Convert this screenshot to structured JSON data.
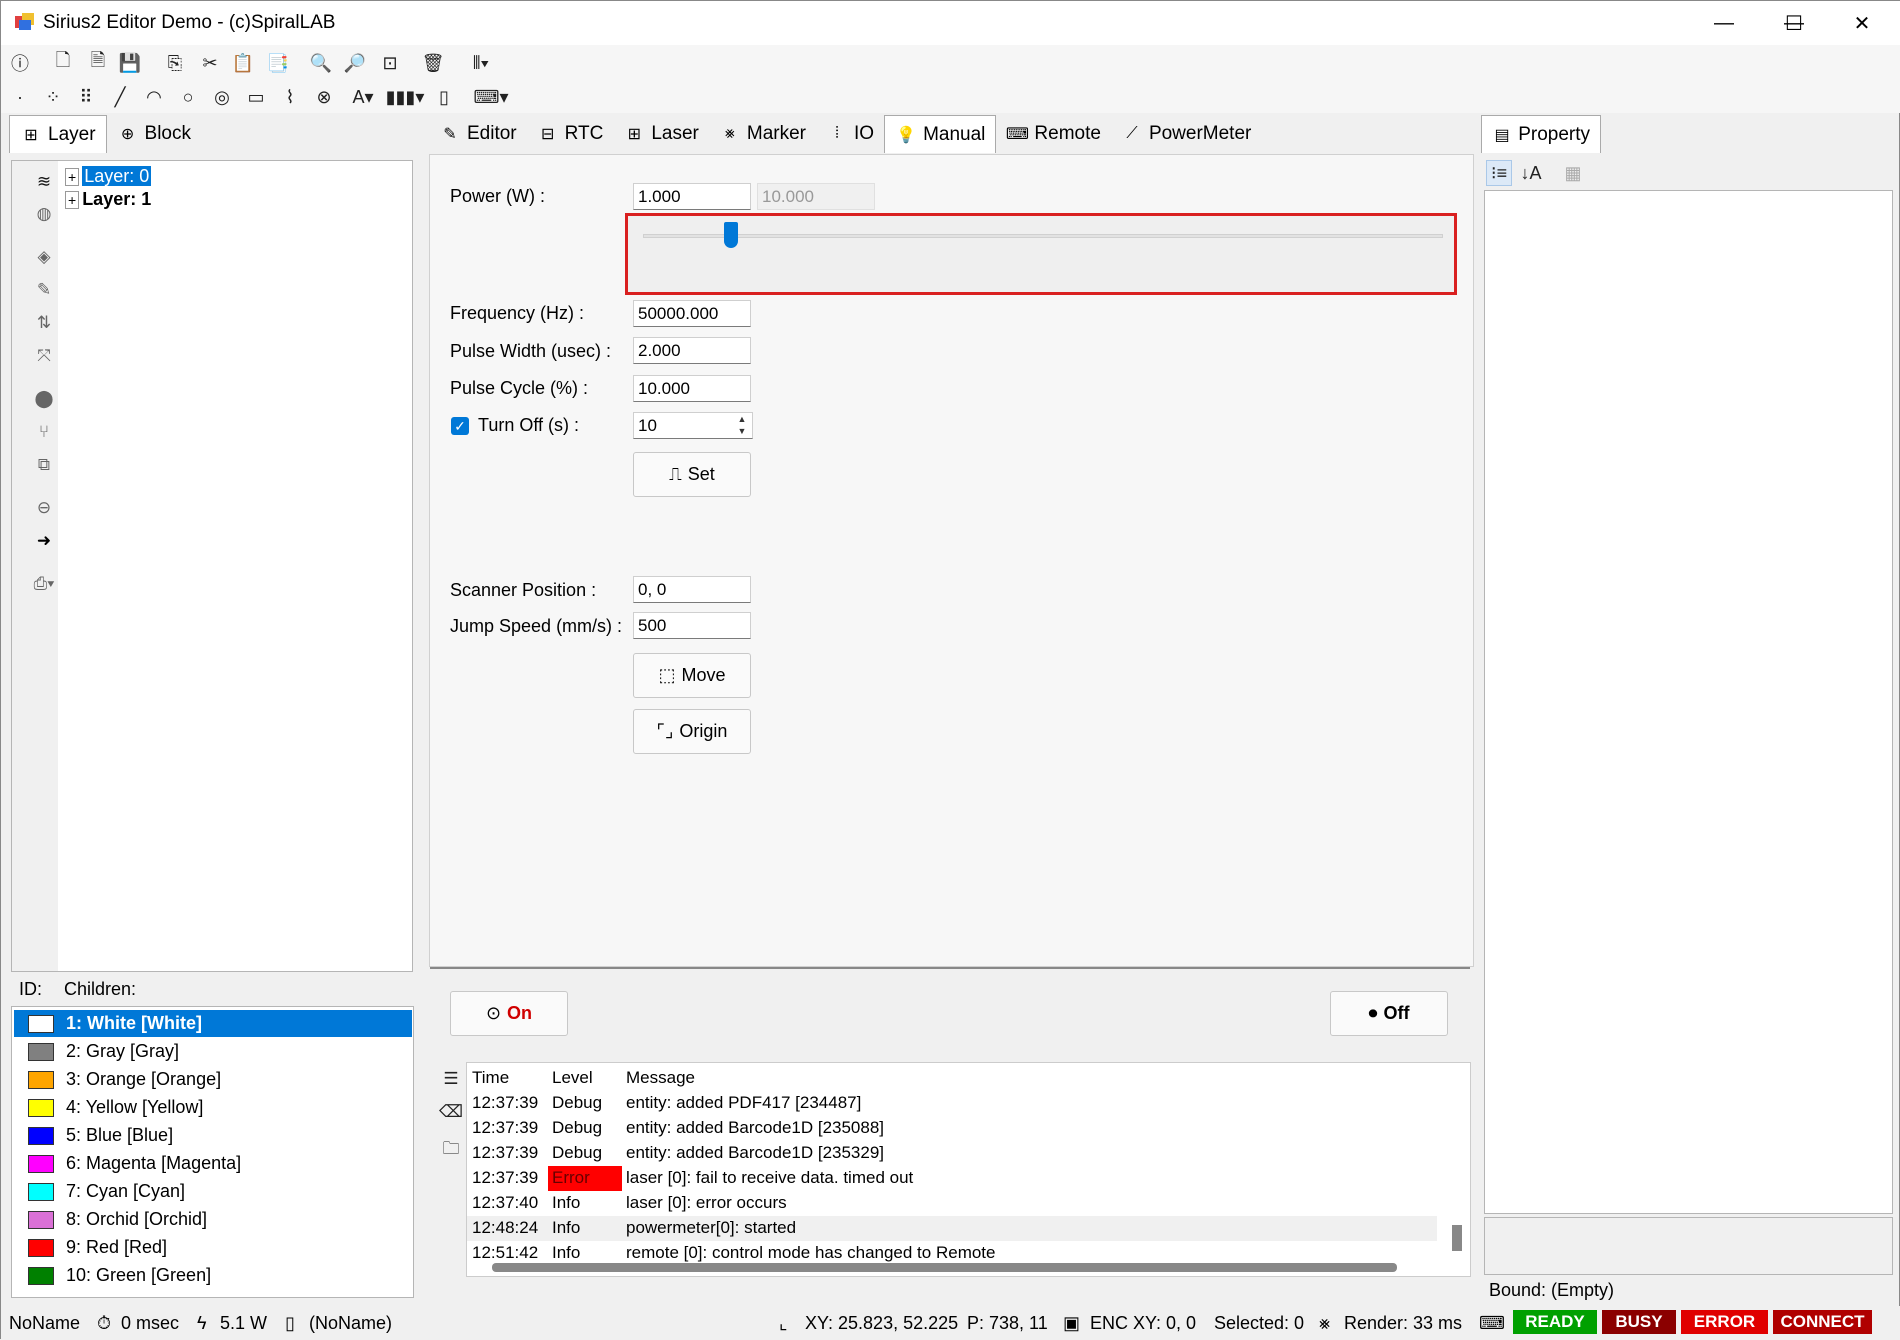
{
  "window": {
    "title": "Sirius2 Editor Demo - (c)SpiralLAB",
    "minimize": "—",
    "maximize": "☐",
    "close": "✕"
  },
  "left_tabs": [
    "Layer",
    "Block"
  ],
  "layer_tree": [
    "Layer: 0",
    "Layer: 1"
  ],
  "center_tabs": [
    "Editor",
    "RTC",
    "Laser",
    "Marker",
    "IO",
    "Manual",
    "Remote",
    "PowerMeter"
  ],
  "right_tab": "Property",
  "manual": {
    "power_label": "Power (W) :",
    "power_value": "1.000",
    "power_max": "10.000",
    "power_fraction": 0.11,
    "freq_label": "Frequency (Hz) :",
    "freq_value": "50000.000",
    "pw_label": "Pulse Width (usec) :",
    "pw_value": "2.000",
    "pc_label": "Pulse Cycle (%) :",
    "pc_value": "10.000",
    "turnoff_label": "Turn Off (s) :",
    "turnoff_value": "10",
    "set_label": "Set",
    "scanpos_label": "Scanner Position :",
    "scanpos_value": "0, 0",
    "jump_label": "Jump Speed (mm/s) :",
    "jump_value": "500",
    "move_label": "Move",
    "origin_label": "Origin",
    "on_label": "On",
    "off_label": "Off"
  },
  "children_header": {
    "id": "ID:",
    "children": "Children:"
  },
  "colors": [
    {
      "label": "1: White [White]",
      "color": "#ffffff"
    },
    {
      "label": "2: Gray [Gray]",
      "color": "#808080"
    },
    {
      "label": "3: Orange [Orange]",
      "color": "#ffa500"
    },
    {
      "label": "4: Yellow [Yellow]",
      "color": "#ffff00"
    },
    {
      "label": "5: Blue [Blue]",
      "color": "#0000ff"
    },
    {
      "label": "6: Magenta [Magenta]",
      "color": "#ff00ff"
    },
    {
      "label": "7: Cyan [Cyan]",
      "color": "#00ffff"
    },
    {
      "label": "8: Orchid [Orchid]",
      "color": "#da70d6"
    },
    {
      "label": "9: Red [Red]",
      "color": "#ff0000"
    },
    {
      "label": "10: Green [Green]",
      "color": "#008000"
    }
  ],
  "log": {
    "headers": [
      "Time",
      "Level",
      "Message"
    ],
    "rows": [
      {
        "time": "12:37:39",
        "level": "Debug",
        "message": "entity: added PDF417 [234487]"
      },
      {
        "time": "12:37:39",
        "level": "Debug",
        "message": "entity: added Barcode1D [235088]"
      },
      {
        "time": "12:37:39",
        "level": "Debug",
        "message": "entity: added Barcode1D [235329]"
      },
      {
        "time": "12:37:39",
        "level": "Error",
        "message": "laser [0]: fail to receive data. timed out"
      },
      {
        "time": "12:37:40",
        "level": "Info",
        "message": "laser [0]: error occurs"
      },
      {
        "time": "12:48:24",
        "level": "Info",
        "message": "powermeter[0]: started"
      },
      {
        "time": "12:51:42",
        "level": "Info",
        "message": "remote [0]: control mode has changed to Remote"
      }
    ]
  },
  "bound": "Bound: (Empty)",
  "status": {
    "name": "NoName",
    "time": "0 msec",
    "power": "5.1 W",
    "doc": "(NoName)",
    "xy": "XY: 25.823, 52.225",
    "p": "P: 738, 11",
    "enc": "ENC XY: 0, 0",
    "selected": "Selected: 0",
    "render": "Render: 33 ms",
    "badges": [
      {
        "label": "READY",
        "color": "#00a000"
      },
      {
        "label": "BUSY",
        "color": "#8b0000"
      },
      {
        "label": "ERROR",
        "color": "#e00000"
      },
      {
        "label": "CONNECT",
        "color": "#b00000"
      }
    ]
  },
  "accent": "#0078d7"
}
